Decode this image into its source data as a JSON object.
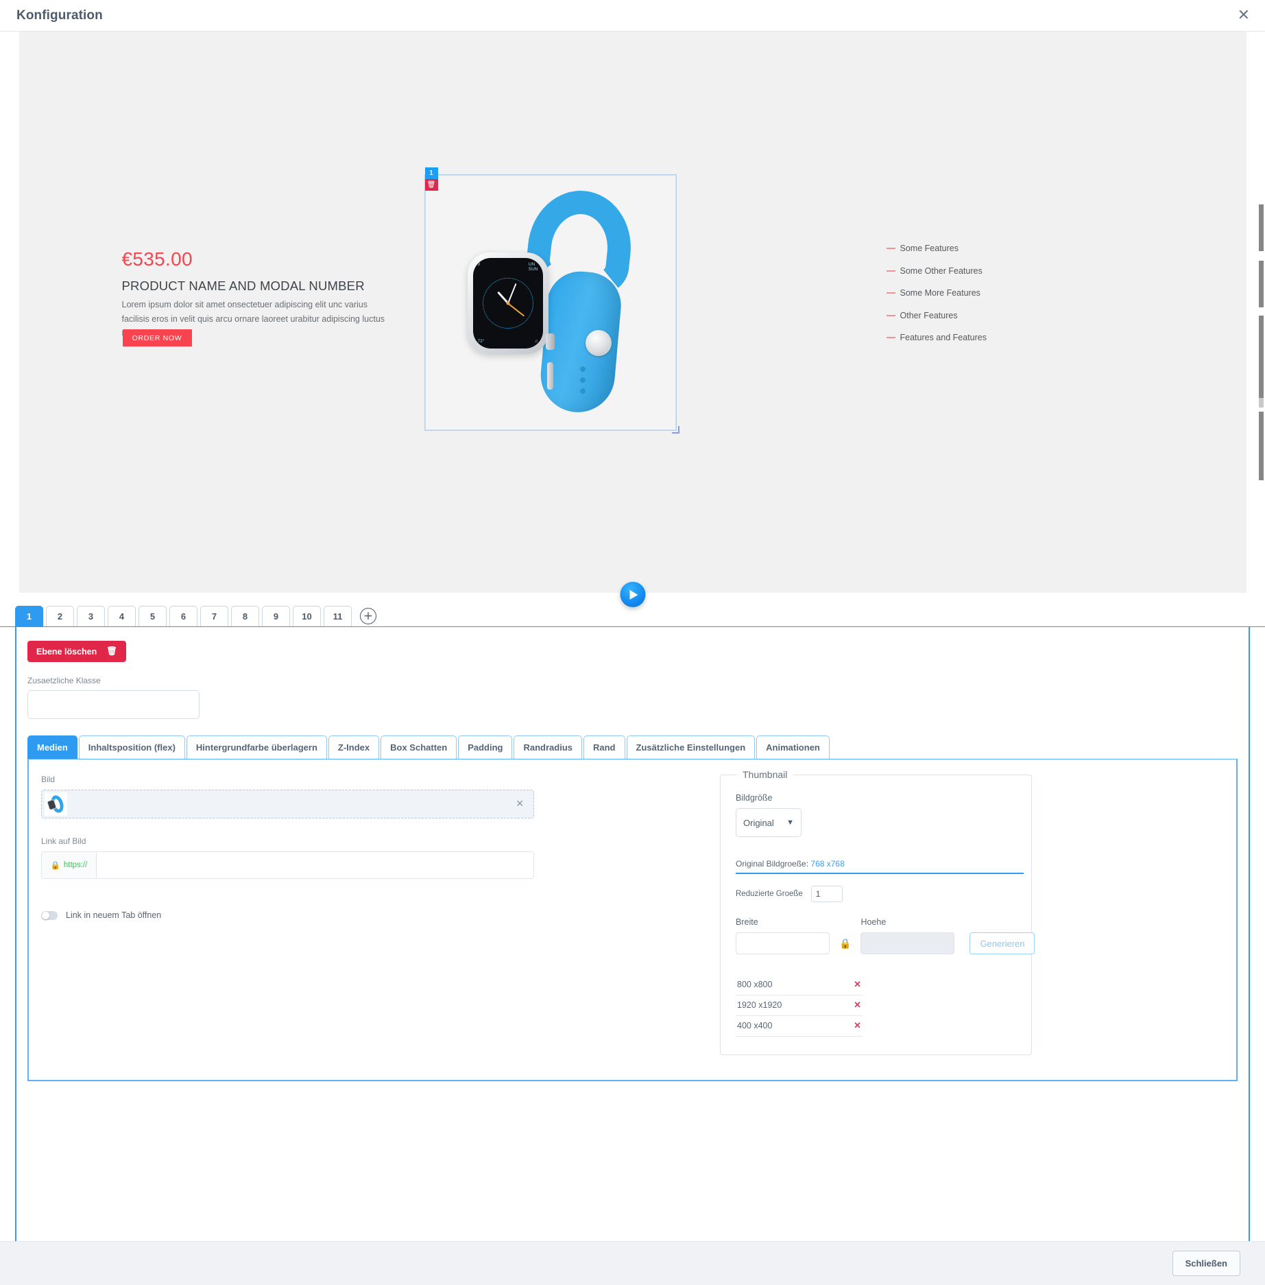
{
  "header": {
    "title": "Konfiguration",
    "close_icon": "close-icon"
  },
  "preview": {
    "price": "€535.00",
    "product_name": "PRODUCT NAME AND MODAL NUMBER",
    "description": "Lorem ipsum dolor sit amet onsectetuer adipiscing elit unc varius facilisis eros in velit quis arcu ornare laoreet urabitur adipiscing luctus massa.",
    "order_button": "ORDER NOW",
    "image_badge_number": "1",
    "image_badge_delete_icon": "trash-icon",
    "play_icon": "play-icon",
    "features": [
      "Some Features",
      "Some Other Features",
      "Some More Features",
      "Other Features",
      "Features and Features"
    ]
  },
  "layer_tabs": {
    "items": [
      "1",
      "2",
      "3",
      "4",
      "5",
      "6",
      "7",
      "8",
      "9",
      "10",
      "11"
    ],
    "active": "1",
    "add_label": "+"
  },
  "panel": {
    "delete_layer_label": "Ebene löschen",
    "delete_layer_icon": "trash-icon",
    "extra_class_label": "Zusaetzliche Klasse",
    "extra_class_value": "",
    "extra_class_placeholder": ""
  },
  "settings_tabs": {
    "items": [
      "Medien",
      "Inhaltsposition (flex)",
      "Hintergrundfarbe überlagern",
      "Z-Index",
      "Box Schatten",
      "Padding",
      "Randradius",
      "Rand",
      "Zusätzliche Einstellungen",
      "Animationen"
    ],
    "active": "Medien"
  },
  "media": {
    "image_label": "Bild",
    "image_remove_icon": "close-icon",
    "image_thumb_icon": "watch-thumbnail",
    "link_label": "Link auf Bild",
    "link_prefix": "https://",
    "link_prefix_icon": "lock-icon",
    "link_value": "",
    "link_placeholder": "",
    "new_tab_toggle_label": "Link in neuem Tab öffnen",
    "new_tab_toggle_state": "off"
  },
  "thumbnail": {
    "legend": "Thumbnail",
    "image_size_label": "Bildgröße",
    "image_size_value": "Original",
    "image_size_options": [
      "Original"
    ],
    "chevron_icon": "chevron-down-icon",
    "original_size_label": "Original Bildgroeße:",
    "original_size_value": "768 x768",
    "reduced_size_label": "Reduzierte Groeße",
    "reduced_size_value": "1",
    "width_label": "Breite",
    "width_value": "",
    "height_label": "Hoehe",
    "height_value": "",
    "lock_icon": "lock-icon",
    "generate_label": "Generieren",
    "sizes": [
      "800 x800",
      "1920 x1920",
      "400 x400"
    ],
    "size_remove_icon": "close-icon"
  },
  "footer": {
    "close_label": "Schließen"
  },
  "colors": {
    "accent_blue": "#2e9bf0",
    "danger_red": "#e02749",
    "price_red": "#f8444f",
    "feature_dash": "#f4918f",
    "link_green": "#3dc456"
  }
}
